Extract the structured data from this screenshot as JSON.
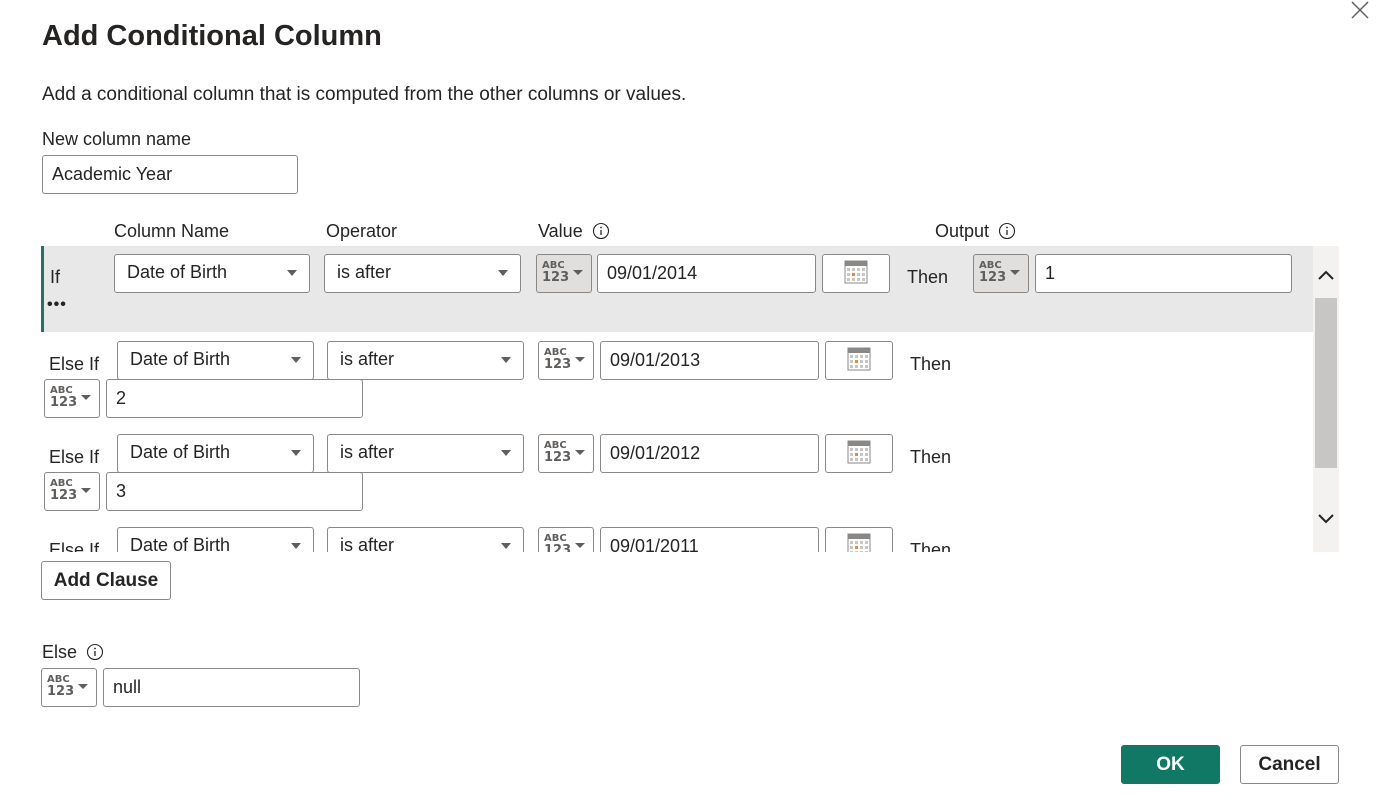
{
  "dialog": {
    "title": "Add Conditional Column",
    "description": "Add a conditional column that is computed from the other columns or values.",
    "new_column_label": "New column name",
    "new_column_value": "Academic Year"
  },
  "headers": {
    "column_name": "Column Name",
    "operator": "Operator",
    "value": "Value",
    "output": "Output"
  },
  "type_icon": {
    "top": "ABC",
    "bottom": "123"
  },
  "then_label": "Then",
  "ellipsis": "•••",
  "clauses": [
    {
      "keyword": "If",
      "column": "Date of Birth",
      "operator": "is after",
      "value": "09/01/2014",
      "output": "1"
    },
    {
      "keyword": "Else If",
      "column": "Date of Birth",
      "operator": "is after",
      "value": "09/01/2013",
      "output": "2"
    },
    {
      "keyword": "Else If",
      "column": "Date of Birth",
      "operator": "is after",
      "value": "09/01/2012",
      "output": "3"
    },
    {
      "keyword": "Else If",
      "column": "Date of Birth",
      "operator": "is after",
      "value": "09/01/2011",
      "output": ""
    }
  ],
  "add_clause_label": "Add Clause",
  "else": {
    "label": "Else",
    "value": "null"
  },
  "buttons": {
    "ok": "OK",
    "cancel": "Cancel"
  },
  "colors": {
    "accent": "#117865",
    "highlight_row": "#e8e8e8"
  }
}
